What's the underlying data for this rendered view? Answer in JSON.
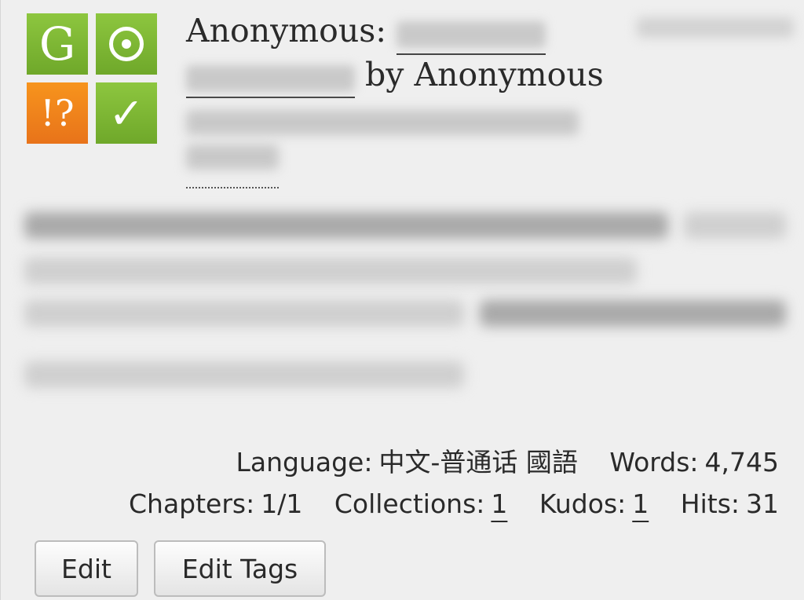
{
  "required_tags": {
    "rating_symbol": "G",
    "category_symbol": "⊙",
    "warning_symbol": "!?",
    "complete_symbol": "✓"
  },
  "heading": {
    "author_prefix": "Anonymous:",
    "by_label": "by Anonymous"
  },
  "stats": {
    "language_label": "Language:",
    "language_value": "中文-普通话 國語",
    "words_label": "Words:",
    "words_value": "4,745",
    "chapters_label": "Chapters:",
    "chapters_value": "1/1",
    "collections_label": "Collections:",
    "collections_value": "1",
    "kudos_label": "Kudos:",
    "kudos_value": "1",
    "hits_label": "Hits:",
    "hits_value": "31"
  },
  "buttons": {
    "edit_label": "Edit",
    "edit_tags_label": "Edit Tags"
  }
}
